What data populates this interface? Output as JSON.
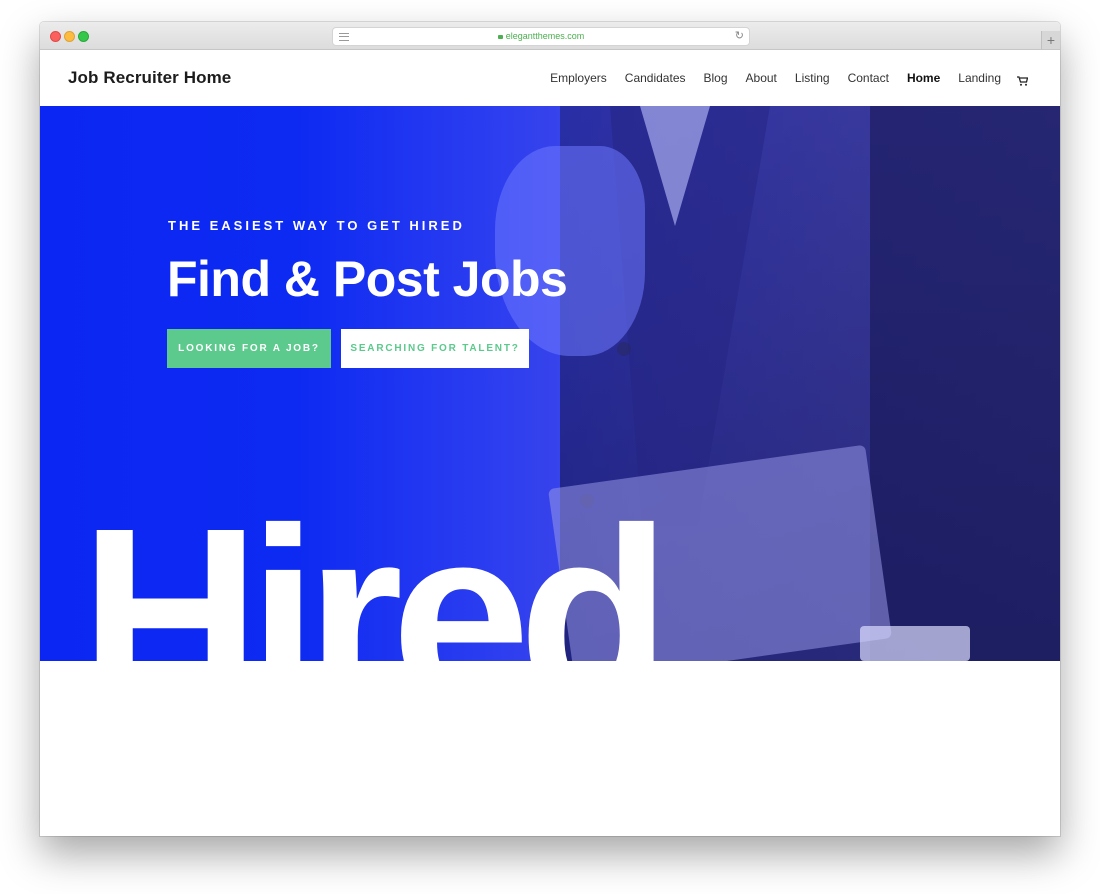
{
  "browser": {
    "url": "elegantthemes.com"
  },
  "site": {
    "logo": "Job Recruiter Home",
    "nav": [
      {
        "label": "Employers"
      },
      {
        "label": "Candidates"
      },
      {
        "label": "Blog"
      },
      {
        "label": "About"
      },
      {
        "label": "Listing"
      },
      {
        "label": "Contact"
      },
      {
        "label": "Home",
        "active": true
      },
      {
        "label": "Landing"
      }
    ],
    "cart_icon": "cart-icon"
  },
  "hero": {
    "eyebrow": "THE EASIEST WAY TO GET HIRED",
    "title": "Find & Post Jobs",
    "primary_button": "LOOKING FOR A JOB?",
    "secondary_button": "SEARCHING FOR TALENT?",
    "big_word": "Hired"
  },
  "colors": {
    "accent": "#5cc98d",
    "hero_blue": "#0b26f2"
  }
}
